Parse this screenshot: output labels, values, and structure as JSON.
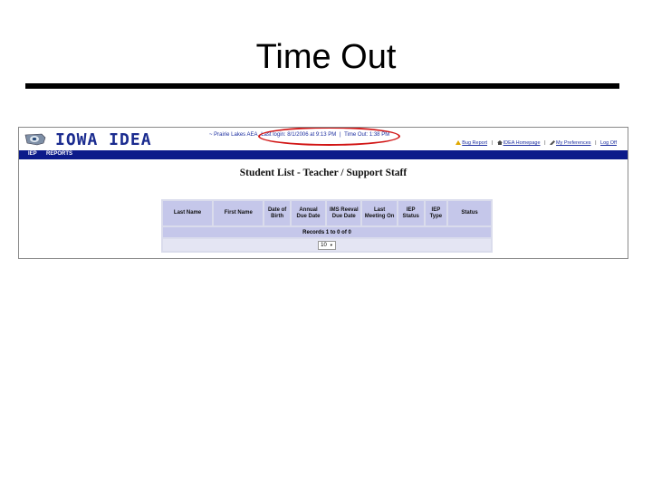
{
  "slide": {
    "title": "Time Out"
  },
  "app": {
    "logo_text": "IOWA IDEA",
    "session": {
      "district": "~ Prairie Lakes AEA",
      "last_login": "Last login: 8/1/2006 at 9:13 PM",
      "separator": "|",
      "timeout": "Time Out: 1:38 PM"
    },
    "utility_links": [
      "Bug Report",
      "IDEA Homepage",
      "My Preferences",
      "Log Off"
    ],
    "utility_separator": "|",
    "nav": [
      "IEP",
      "REPORTS"
    ],
    "page_title": "Student List - Teacher / Support Staff",
    "table": {
      "columns": [
        "Last Name",
        "First Name",
        "Date of Birth",
        "Annual Due Date",
        "IMS Reeval Due Date",
        "Last Meeting On",
        "IEP Status",
        "IEP Type",
        "Status"
      ],
      "records_text": "Records 1 to 0 of 0",
      "page_size": "10"
    },
    "colors": {
      "nav_bar": "#0c1b8a",
      "logo": "#1a2b8f",
      "highlight_oval": "#d11414",
      "table_header": "#c5c7ea"
    }
  }
}
